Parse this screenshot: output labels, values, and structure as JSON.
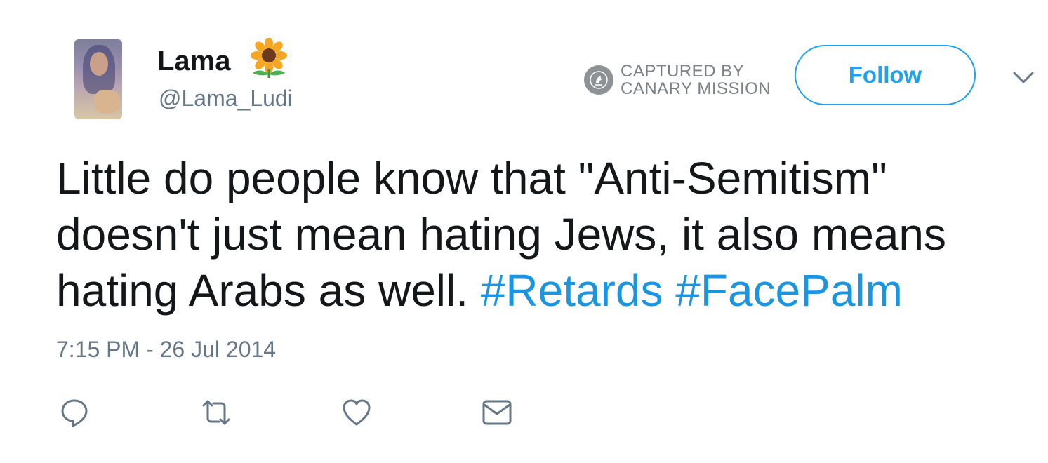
{
  "author": {
    "name": "Lama",
    "handle": "@Lama_Ludi",
    "name_emoji": "sunflower-emoji"
  },
  "watermark": {
    "line1": "CAPTURED BY",
    "line2": "CANARY MISSION",
    "icon": "canary-icon"
  },
  "follow_button": {
    "label": "Follow"
  },
  "tweet": {
    "text": "Little do people know that \"Anti-Semitism\" doesn't just mean hating Jews, it also means hating Arabs as well.",
    "hashtags": [
      "#Retards",
      "#FacePalm"
    ],
    "timestamp": "7:15 PM - 26 Jul 2014"
  },
  "actions": [
    {
      "name": "reply",
      "icon": "reply-icon"
    },
    {
      "name": "retweet",
      "icon": "retweet-icon"
    },
    {
      "name": "like",
      "icon": "heart-icon"
    },
    {
      "name": "direct-message",
      "icon": "envelope-icon"
    }
  ],
  "colors": {
    "accent": "#1da1f2",
    "hashtag": "#1b95e0",
    "secondary_text": "#657786",
    "primary_text": "#14171a",
    "watermark": "#7a8085"
  }
}
